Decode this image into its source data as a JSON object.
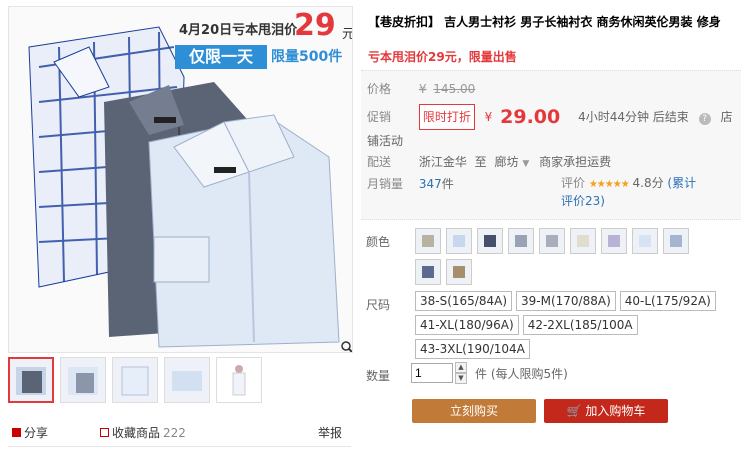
{
  "banner": {
    "date_text": "4月20日亏本甩泪价",
    "price": "29",
    "yuan": "元",
    "limit_text": "仅限一天",
    "limit_qty": "限量500件"
  },
  "left_bottom": {
    "share": "分享",
    "favorite": "收藏商品",
    "favorite_count": "222",
    "report": "举报"
  },
  "product": {
    "title": "【巷皮折扣】 吉人男士衬衫 男子长袖衬衣 商务休闲英伦男装 修身",
    "subtitle": "亏本甩泪价29元，限量出售",
    "price_label": "价格",
    "price_symbol": "¥",
    "price_original": "145.00",
    "promo_label": "促销",
    "promo_tag": "限时打折",
    "promo_symbol": "¥",
    "promo_price": "29.00",
    "promo_time": "4小时44分钟 后结束",
    "promo_shop": "店铺活动",
    "ship_label": "配送",
    "ship_from": "浙江金华",
    "ship_to_word": "至",
    "ship_to": "廊坊",
    "ship_fee": "商家承担运费",
    "sales_label": "月销量",
    "sales_count": "347",
    "sales_unit": "件",
    "rating_label": "评价",
    "stars": "★★★★★",
    "rating_score": "4.8分",
    "rating_link": "(累计评价23)"
  },
  "options": {
    "color_label": "颜色",
    "size_label": "尺码",
    "sizes": [
      "38-S(165/84A)",
      "39-M(170/88A)",
      "40-L(175/92A)",
      "41-XL(180/96A)",
      "42-2XL(185/100A",
      "43-3XL(190/104A"
    ],
    "qty_label": "数量",
    "qty_value": "1",
    "qty_note": "件 (每人限购5件)",
    "buy_now": "立刻购买",
    "add_cart": "加入购物车"
  },
  "colors": {
    "accent": "#e4393c",
    "banner_blue": "#2e8fd6",
    "buy_button": "#c27a38",
    "cart_button": "#c4281b"
  }
}
